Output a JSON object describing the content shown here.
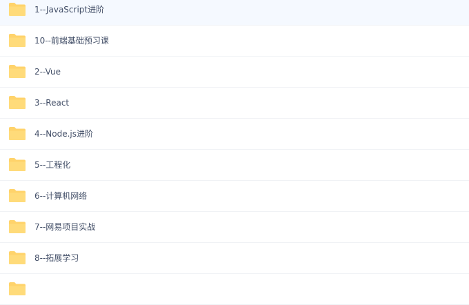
{
  "file_list": {
    "icon": "folder-icon",
    "icon_color": "#ffd36b",
    "items": [
      {
        "name": "1--JavaScript进阶"
      },
      {
        "name": "10--前端基础预习课"
      },
      {
        "name": "2--Vue"
      },
      {
        "name": "3--React"
      },
      {
        "name": "4--Node.js进阶"
      },
      {
        "name": "5--工程化"
      },
      {
        "name": "6--计算机网络"
      },
      {
        "name": "7--网易项目实战"
      },
      {
        "name": "8--拓展学习"
      },
      {
        "name": ""
      }
    ]
  }
}
